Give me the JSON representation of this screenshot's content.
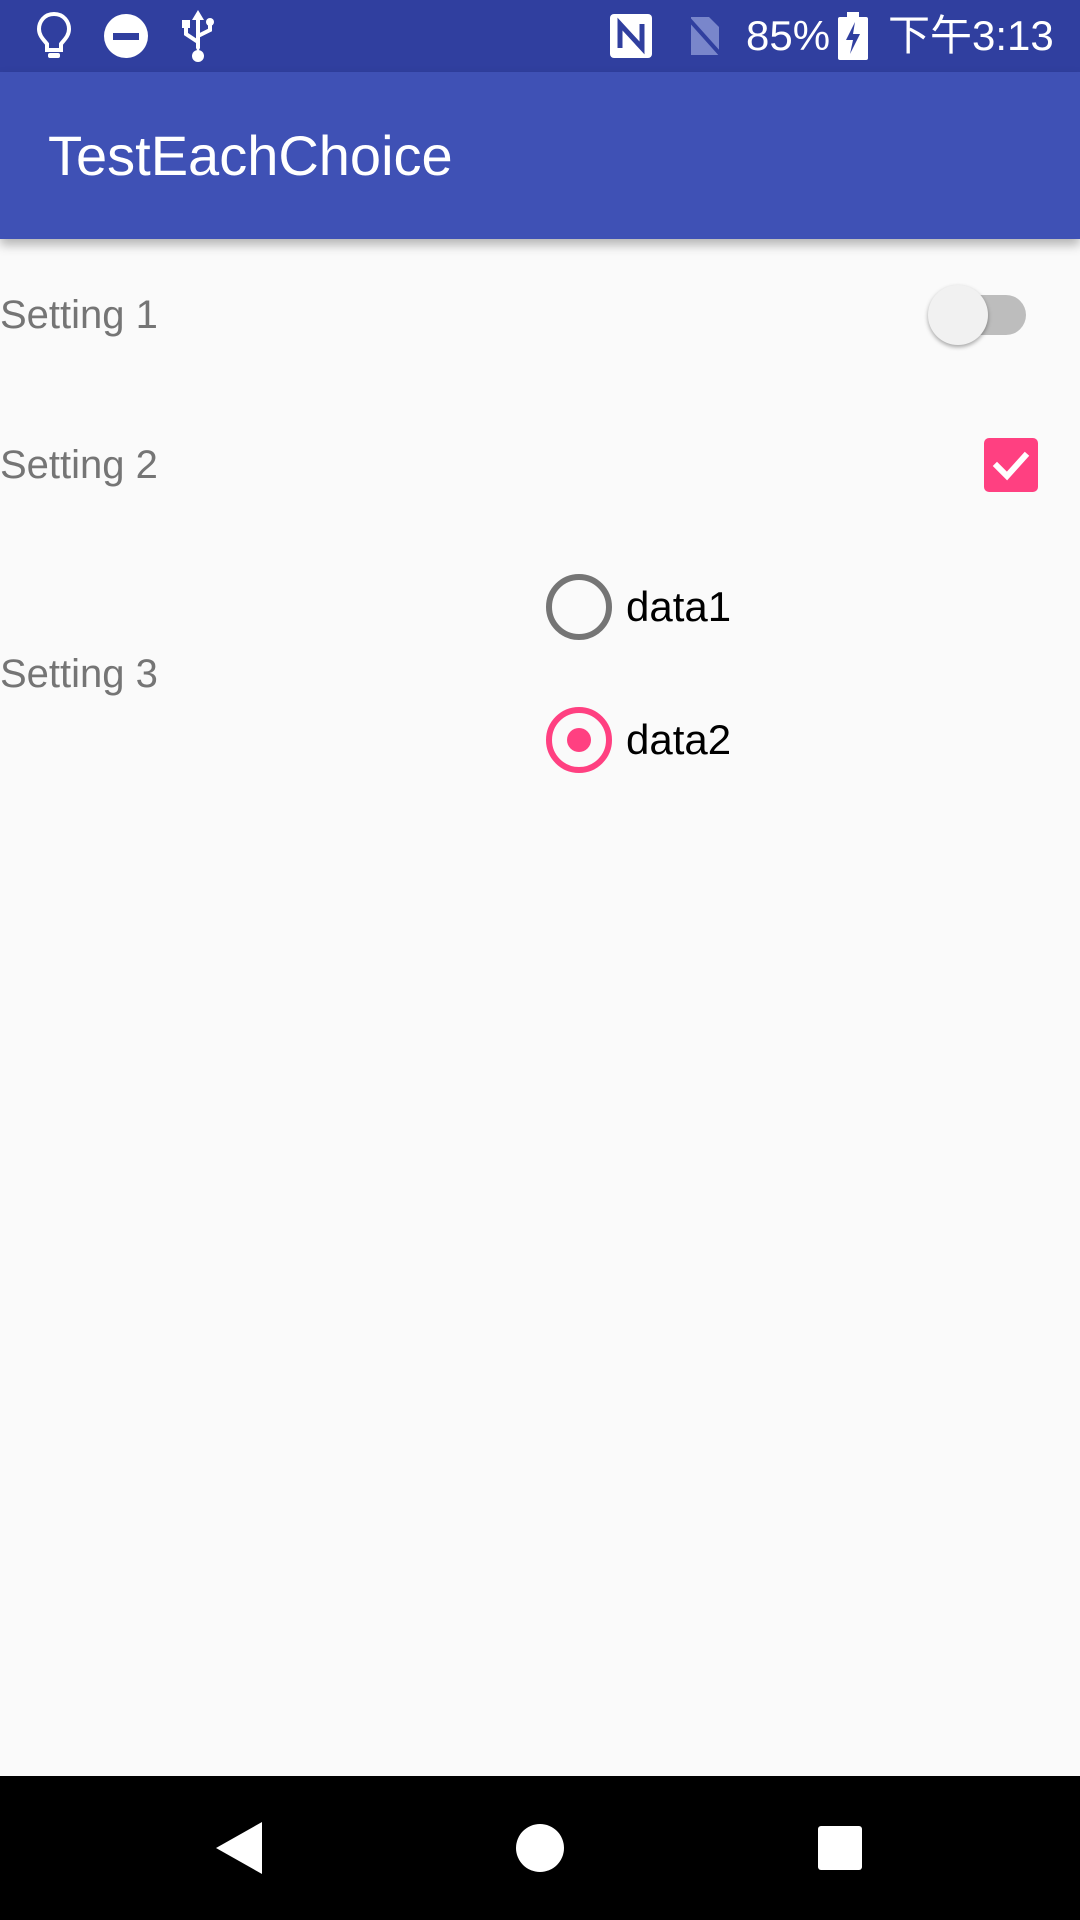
{
  "status_bar": {
    "left_icons": [
      "lightbulb-icon",
      "do-not-disturb-icon",
      "usb-icon"
    ],
    "right_icons": [
      "nfc-icon",
      "no-sim-icon",
      "battery-charging-icon"
    ],
    "battery": "85%",
    "time": "下午3:13"
  },
  "app_bar": {
    "title": "TestEachChoice"
  },
  "settings": {
    "setting1": {
      "label": "Setting 1",
      "control": "switch",
      "checked": false
    },
    "setting2": {
      "label": "Setting 2",
      "control": "checkbox",
      "checked": true
    },
    "setting3": {
      "label": "Setting 3",
      "control": "radio-group",
      "options": [
        {
          "label": "data1",
          "selected": false
        },
        {
          "label": "data2",
          "selected": true
        }
      ]
    }
  },
  "nav_bar": {
    "buttons": [
      "back-icon",
      "home-icon",
      "recents-icon"
    ]
  },
  "colors": {
    "status_bar": "#303f9f",
    "app_bar": "#3f51b5",
    "accent": "#ff4081",
    "background": "#fafafa",
    "label_text": "#757575"
  }
}
